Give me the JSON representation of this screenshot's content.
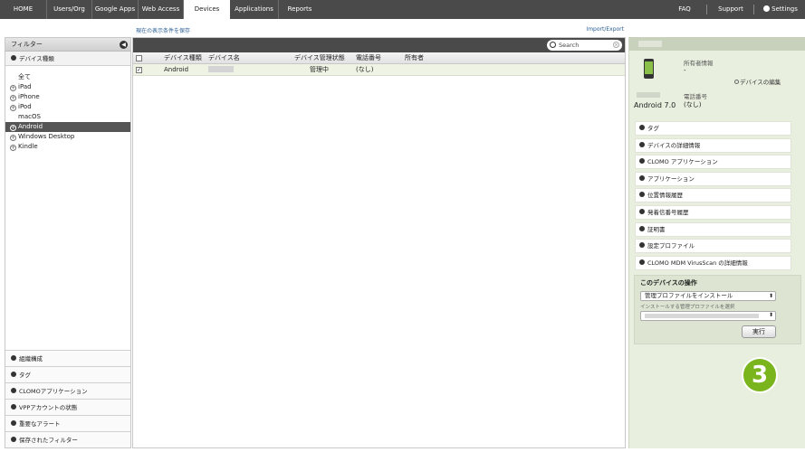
{
  "nav": {
    "tabs": [
      "HOME",
      "Users/Org",
      "Google Apps",
      "Web Access",
      "Devices",
      "Applications",
      "Reports"
    ],
    "active_tab": "Devices",
    "faq": "FAQ",
    "support": "Support",
    "settings": "Settings"
  },
  "links": {
    "save_filter": "現在の表示条件を保存",
    "import_export": "Import/Export"
  },
  "left": {
    "header": "フィルター",
    "section_device_type": "デバイス種類",
    "device_types": [
      {
        "label": "全て",
        "expand": false,
        "selected": false
      },
      {
        "label": "iPad",
        "expand": true,
        "selected": false
      },
      {
        "label": "iPhone",
        "expand": true,
        "selected": false
      },
      {
        "label": "iPod",
        "expand": true,
        "selected": false
      },
      {
        "label": "macOS",
        "expand": false,
        "selected": false
      },
      {
        "label": "Android",
        "expand": true,
        "selected": true
      },
      {
        "label": "Windows Desktop",
        "expand": true,
        "selected": false
      },
      {
        "label": "Kindle",
        "expand": true,
        "selected": false
      }
    ],
    "bottom_sections": [
      "組織構成",
      "タグ",
      "CLOMOアプリケーション",
      "VPPアカウントの状態",
      "重要なアラート",
      "保存されたフィルター"
    ]
  },
  "table": {
    "search_placeholder": "Search",
    "headers": [
      "デバイス種類",
      "デバイス名",
      "デバイス管理状態",
      "電話番号",
      "所有者"
    ],
    "rows": [
      {
        "type": "Android",
        "status": "管理中",
        "phone": "(なし)"
      }
    ]
  },
  "detail": {
    "os": "Android 7.0",
    "owner_label": "所有者情報",
    "owner_value": "-",
    "edit_link": "デバイスの編集",
    "phone_label": "電話番号",
    "phone_value": "(なし)",
    "sections": [
      "タグ",
      "デバイスの詳細情報",
      "CLOMO アプリケーション",
      "アプリケーション",
      "位置情報履歴",
      "発着信番号履歴",
      "証明書",
      "設定プロファイル",
      "CLOMO MDM VirusScan の詳細情報"
    ],
    "ops": {
      "title": "このデバイスの操作",
      "action": "管理プロファイルをインストール",
      "profile_label": "インストールする管理プロファイルを選択",
      "run": "実行"
    }
  },
  "step_badge": "3"
}
